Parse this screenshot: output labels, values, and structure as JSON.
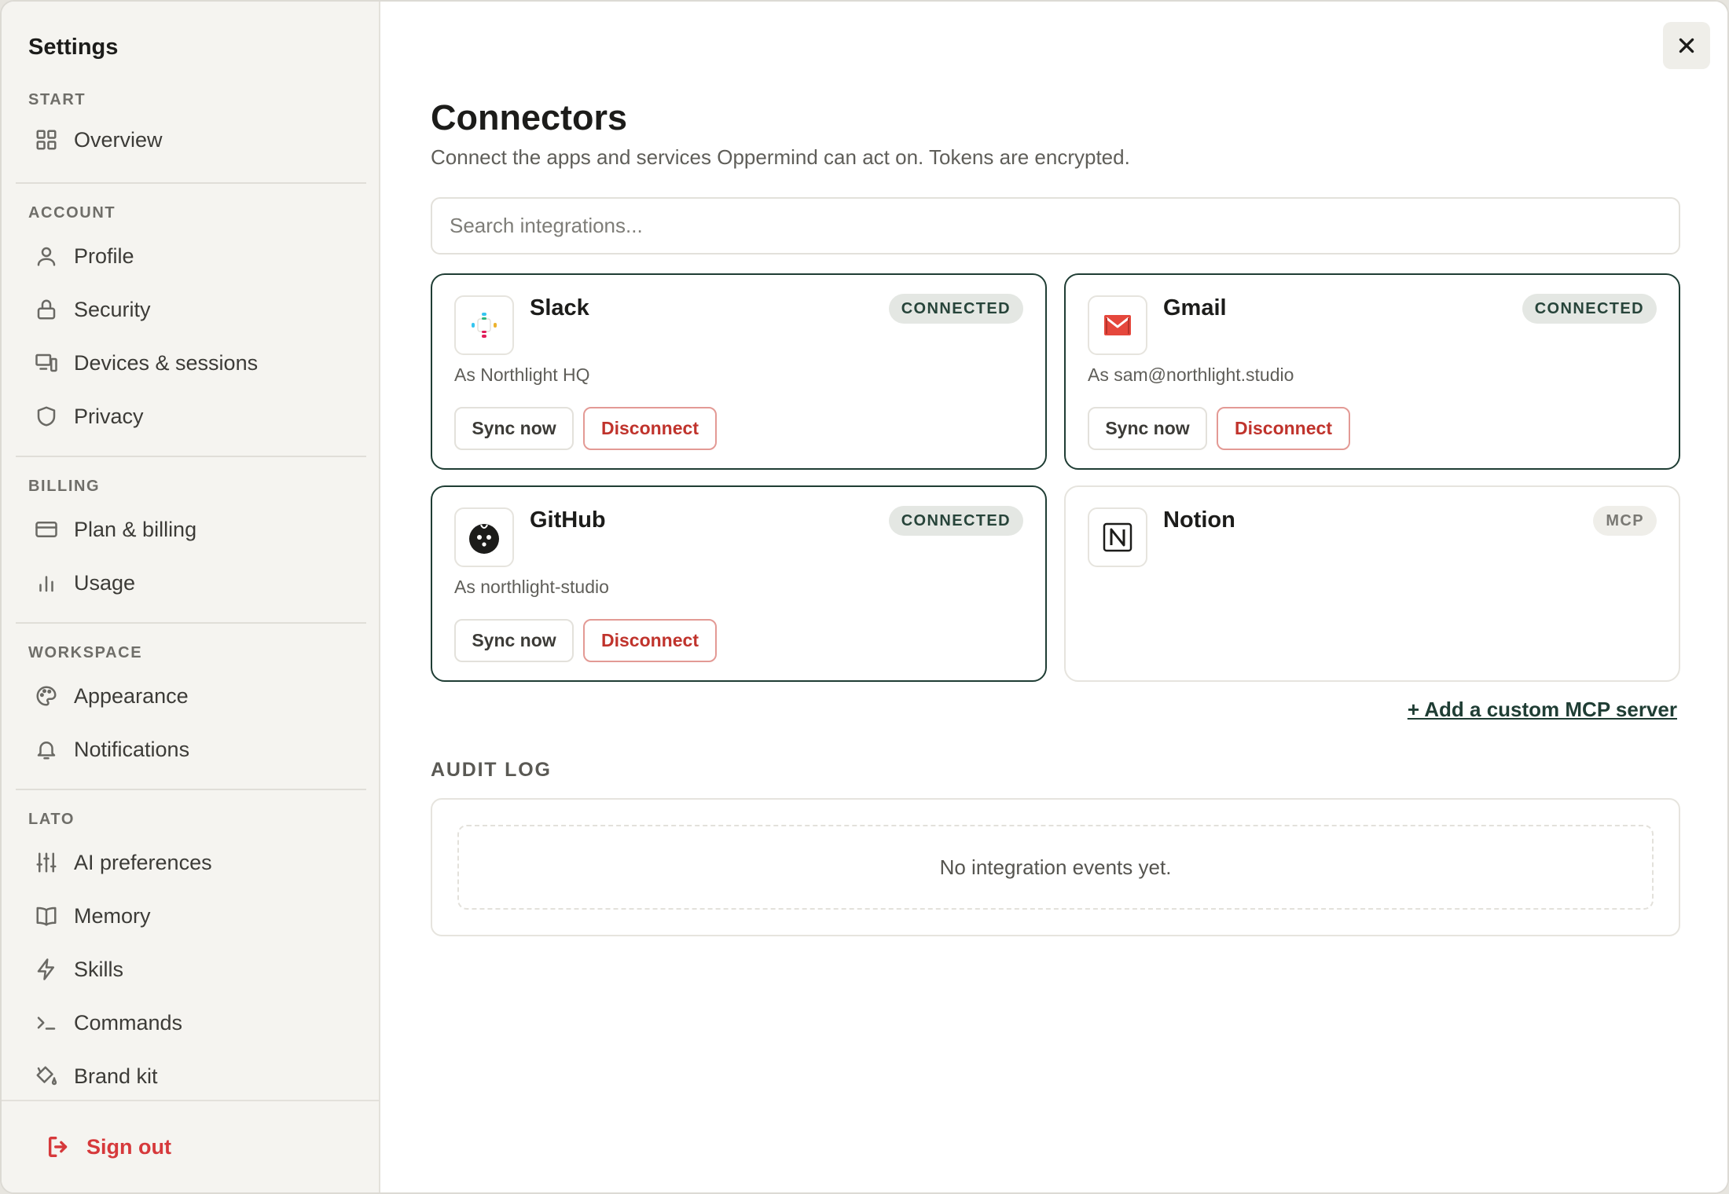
{
  "sidebar": {
    "title": "Settings",
    "sections": {
      "start": "START",
      "account": "ACCOUNT",
      "billing": "BILLING",
      "workspace": "WORKSPACE",
      "lato": "LATO"
    },
    "items": {
      "overview": "Overview",
      "profile": "Profile",
      "security": "Security",
      "devices": "Devices & sessions",
      "privacy": "Privacy",
      "plan": "Plan & billing",
      "usage": "Usage",
      "appearance": "Appearance",
      "notifications": "Notifications",
      "ai_preferences": "AI preferences",
      "memory": "Memory",
      "skills": "Skills",
      "commands": "Commands",
      "brand_kit": "Brand kit"
    },
    "sign_out": "Sign out"
  },
  "main": {
    "title": "Connectors",
    "subtitle": "Connect the apps and services Oppermind can act on. Tokens are encrypted.",
    "search": {
      "placeholder": "Search integrations..."
    },
    "connectors": [
      {
        "name": "Slack",
        "status": "CONNECTED",
        "account": "As Northlight HQ",
        "sync": "Sync now",
        "disconnect": "Disconnect",
        "icon": "slack-icon"
      },
      {
        "name": "Gmail",
        "status": "CONNECTED",
        "account": "As sam@northlight.studio",
        "sync": "Sync now",
        "disconnect": "Disconnect",
        "icon": "gmail-icon"
      },
      {
        "name": "GitHub",
        "status": "CONNECTED",
        "account": "As northlight-studio",
        "sync": "Sync now",
        "disconnect": "Disconnect",
        "icon": "github-icon"
      },
      {
        "name": "Notion",
        "status": "MCP",
        "icon": "notion-icon"
      }
    ],
    "add_custom": "+ Add a custom MCP server",
    "audit": {
      "label": "AUDIT LOG",
      "empty": "No integration events yet."
    }
  },
  "colors": {
    "accent": "#1f3d34",
    "danger": "#d6393b",
    "sidebar_bg": "#f5f4f0"
  }
}
